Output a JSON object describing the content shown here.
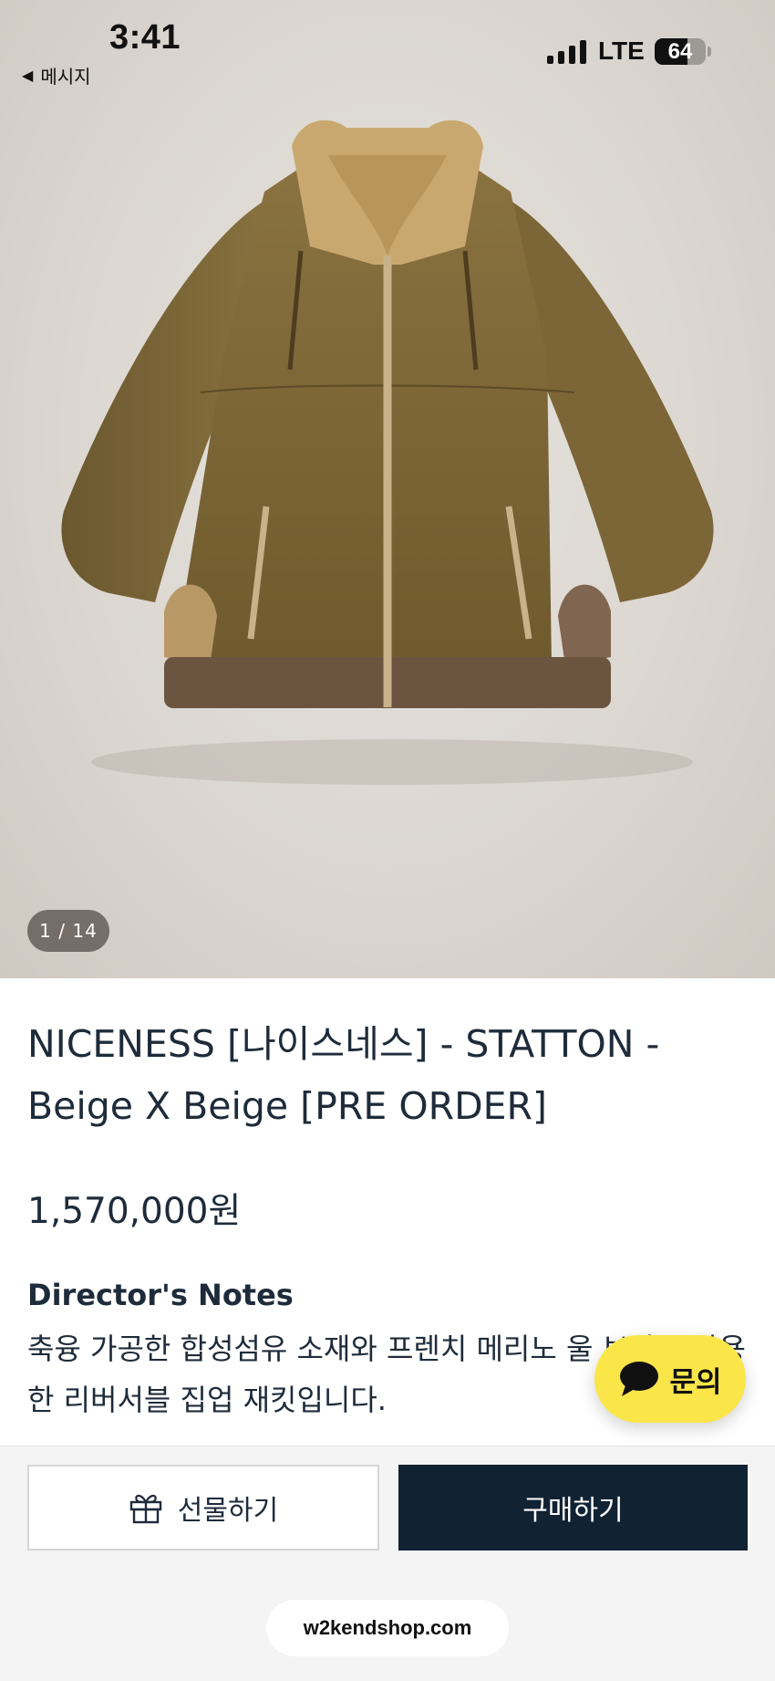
{
  "status_bar": {
    "time": "3:41",
    "back_label": "메시지",
    "network": "LTE",
    "battery": "64",
    "battery_level": 0.64
  },
  "gallery": {
    "counter": "1 / 14"
  },
  "product": {
    "title": "NICENESS [나이스네스] - STATTON - Beige X Beige [PRE ORDER]",
    "price": "1,570,000원",
    "notes_heading": "Director's Notes",
    "notes_body": "축융 가공한 합성섬유 소재와 프렌치 메리노 울 보아를 사용한 리버서블 집업 재킷입니다."
  },
  "chat": {
    "label": "문의",
    "color": "#fbe64a"
  },
  "actions": {
    "gift_label": "선물하기",
    "buy_label": "구매하기",
    "buy_color": "#112233"
  },
  "browser": {
    "domain": "w2kendshop.com"
  }
}
